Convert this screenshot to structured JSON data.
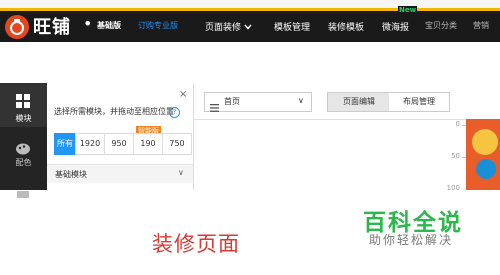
{
  "colors": {
    "accent_bar": "#f2b705",
    "nav_bg": "#1a1a1a",
    "primary": "#2196f3",
    "new_badge": "#2ecc71",
    "caption": "#d63b36",
    "watermark": "#2db84d"
  },
  "header": {
    "brand": "旺铺",
    "brand_dot": "•",
    "edition": "基础版",
    "upgrade_link": "订购专业版",
    "logo_icon": "wangpu-logo-icon",
    "nav": [
      {
        "label": "页面装修",
        "chevron": "chevron-down-icon"
      },
      {
        "label": "模板管理"
      },
      {
        "label": "装修模板"
      },
      {
        "label": "微海报",
        "badge": "New"
      },
      {
        "label": "宝贝分类"
      },
      {
        "label": "营销"
      }
    ]
  },
  "left_rail": {
    "items": [
      {
        "label": "模块",
        "icon": "grid-icon",
        "active": true
      },
      {
        "label": "配色",
        "icon": "palette-icon",
        "active": false
      },
      {
        "label": "",
        "icon": "square-icon",
        "active": false
      }
    ]
  },
  "module_panel": {
    "hint": "选择所需模块，并拖动至相应位置",
    "help_icon": "help-icon",
    "help_glyph": "?",
    "close_icon": "close-icon",
    "close_glyph": "×",
    "width_tabs": [
      "所有",
      "1920",
      "950",
      "190",
      "750"
    ],
    "smart_badge": "智能版",
    "section_title": "基础模块",
    "section_caret": "chevron-down-icon",
    "section_caret_glyph": "∨"
  },
  "workspace": {
    "page_select": {
      "value": "首页",
      "icon": "menu-icon",
      "dropdown": "chevron-down-icon",
      "dropdown_glyph": "∨"
    },
    "mode_tabs": [
      {
        "label": "页面编辑",
        "active": true
      },
      {
        "label": "布局管理",
        "active": false
      }
    ],
    "ruler_ticks": [
      "0",
      "50",
      "100"
    ]
  },
  "caption": "装修页面",
  "watermark": {
    "title": "百科全说",
    "subtitle": "助你轻松解决"
  }
}
